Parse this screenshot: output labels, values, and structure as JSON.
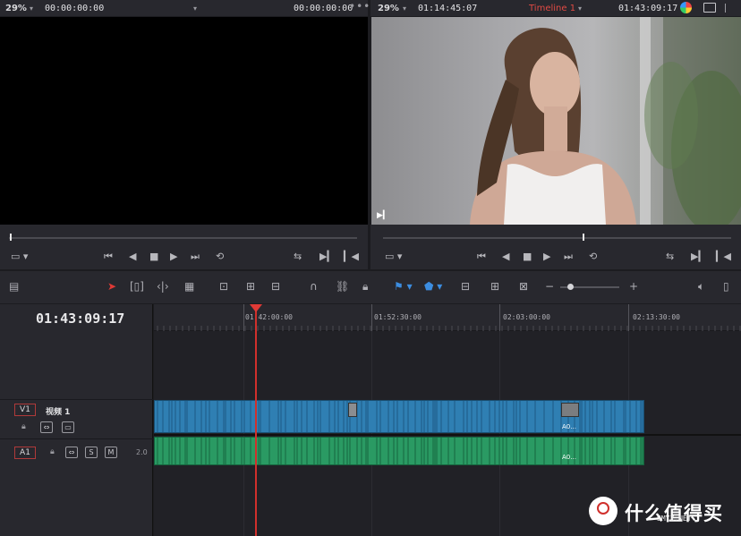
{
  "source_monitor": {
    "zoom": "29%",
    "timecode_left": "00:00:00:00",
    "timecode_right": "00:00:00:00",
    "more": "•••"
  },
  "program_monitor": {
    "zoom": "29%",
    "timecode_left": "01:14:45:07",
    "timeline_name": "Timeline 1",
    "timecode_right": "01:43:09:17"
  },
  "timeline": {
    "current_timecode": "01:43:09:17",
    "ruler_labels": [
      "01:42:00:00",
      "01:52:30:00",
      "02:03:00:00",
      "02:13:30:00"
    ],
    "tracks": {
      "video": {
        "id": "V1",
        "name": "视频 1"
      },
      "audio": {
        "id": "A1",
        "channels": "2.0",
        "solo": "S",
        "mute": "M"
      }
    },
    "clip_labels": {
      "video": "A0...",
      "audio": "A0..."
    }
  },
  "colors": {
    "accent_red": "#e03a36",
    "video_clip": "#2f7fb3",
    "audio_clip": "#2a9a63",
    "tool_blue": "#3c8de0"
  },
  "watermark": {
    "text": "什么值得买",
    "sub": "SMYZ.NET"
  }
}
